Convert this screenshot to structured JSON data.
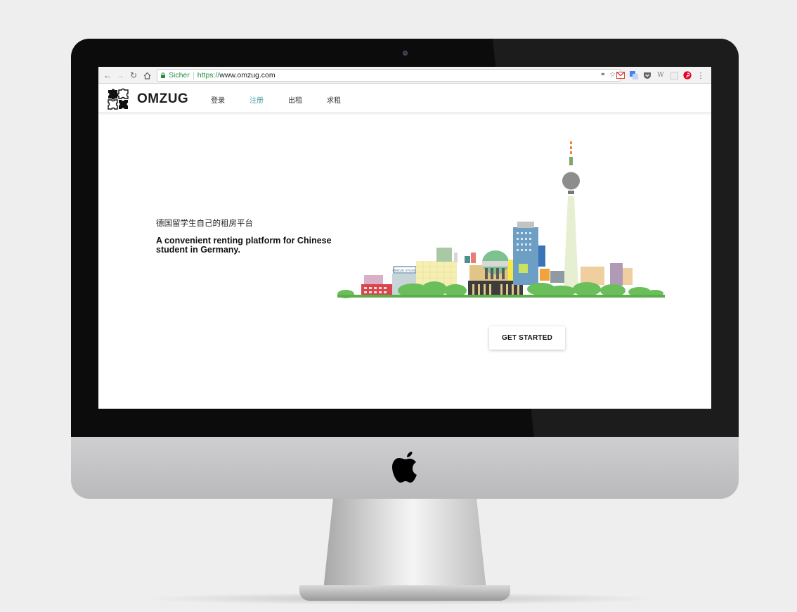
{
  "browser": {
    "secure_label": "Sicher",
    "url_scheme": "https://",
    "url_host": "www.omzug.com",
    "nav_icons": [
      "back-arrow-icon",
      "forward-arrow-icon",
      "reload-icon",
      "home-icon"
    ],
    "extension_icons": [
      "gmail-icon",
      "translate-icon",
      "pocket-icon",
      "wikipedia-icon",
      "blank-extension-icon",
      "pinterest-icon",
      "more-menu-icon"
    ]
  },
  "site": {
    "logo_text": "OMZUG",
    "nav": [
      {
        "label": "登录",
        "active": false
      },
      {
        "label": "注册",
        "active": true
      },
      {
        "label": "出租",
        "active": false
      },
      {
        "label": "求租",
        "active": false
      }
    ]
  },
  "hero": {
    "tagline_cn": "德国留学生自己的租房平台",
    "tagline_en": "A convenient renting platform for Chinese student in Germany.",
    "cta_label": "GET STARTED",
    "sign_text": "OMZUG STUDIO"
  },
  "colors": {
    "accent": "#4aa1a6",
    "secure_green": "#1e8e3e",
    "tree_green": "#6abf5b"
  }
}
